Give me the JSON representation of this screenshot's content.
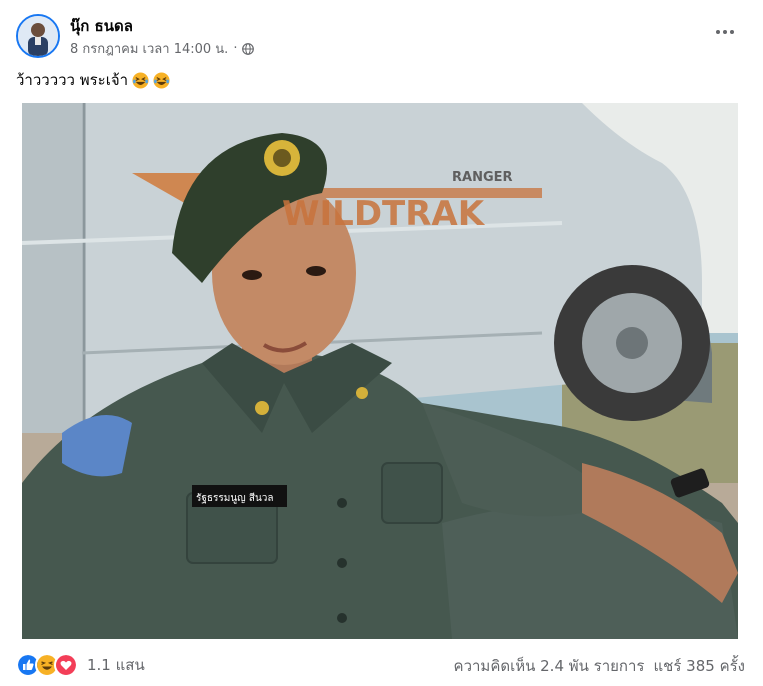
{
  "post": {
    "author": "นุ๊ก ธนดล",
    "date": "8 กรกฎาคม เวลา 14:00 น.",
    "separator": "·",
    "caption": "ว้าววววว พระเจ้า",
    "icons": {
      "privacy": "globe-icon",
      "more": "more-options-icon",
      "caption_emoji": "laughing-emoji"
    }
  },
  "photo": {
    "truck_text_brand": "RANGER",
    "truck_text_model": "WILDTRAK",
    "name_tag": "รัฐธรรมนูญ สีนวล"
  },
  "footer": {
    "reaction_icons": [
      "like-icon",
      "haha-icon",
      "love-icon"
    ],
    "reaction_count": "1.1 แสน",
    "comments": "ความคิดเห็น 2.4 พัน รายการ",
    "shares": "แชร์ 385 ครั้ง"
  },
  "colors": {
    "brand_blue": "#1877f2",
    "secondary_text": "#65676b",
    "love_red": "#f33e58",
    "haha_yellow": "#f7b125"
  }
}
